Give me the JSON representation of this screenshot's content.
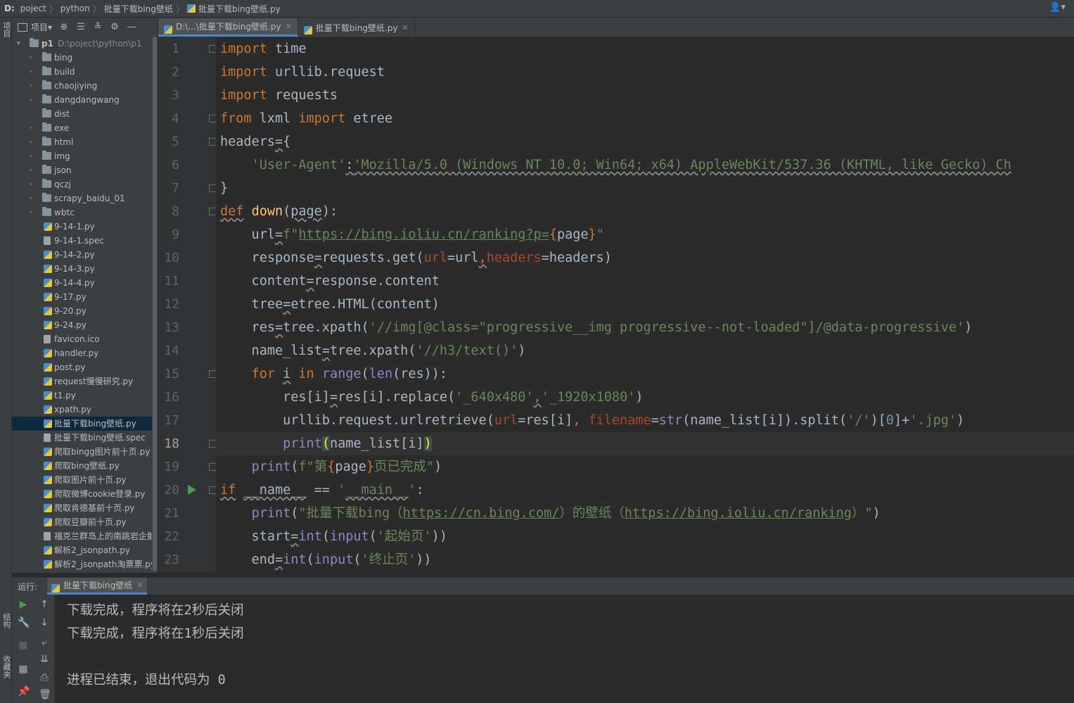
{
  "breadcrumb": {
    "drive": "D:",
    "items": [
      "poject",
      "python",
      "批量下载bing壁纸",
      "批量下载bing壁纸.py"
    ]
  },
  "left_strip": {
    "project_label": "项目",
    "structure_label": "结构",
    "favorites_label": "收藏夹"
  },
  "project_toolbar": {
    "view_label": "项目▾"
  },
  "tree": {
    "root": {
      "name": "p1",
      "path": "D:\\poject\\python\\p1"
    },
    "folders": [
      "bing",
      "build",
      "chaojiying",
      "dangdangwang",
      "dist",
      "exe",
      "html",
      "img",
      "json",
      "qczj",
      "scrapy_baidu_01",
      "wbtc"
    ],
    "files": [
      {
        "name": "9-14-1.py",
        "type": "py"
      },
      {
        "name": "9-14-1.spec",
        "type": "file"
      },
      {
        "name": "9-14-2.py",
        "type": "py"
      },
      {
        "name": "9-14-3.py",
        "type": "py"
      },
      {
        "name": "9-14-4.py",
        "type": "py"
      },
      {
        "name": "9-17.py",
        "type": "py"
      },
      {
        "name": "9-20.py",
        "type": "py"
      },
      {
        "name": "9-24.py",
        "type": "py"
      },
      {
        "name": "favicon.ico",
        "type": "file"
      },
      {
        "name": "handler.py",
        "type": "py"
      },
      {
        "name": "post.py",
        "type": "py"
      },
      {
        "name": "request慢慢研究.py",
        "type": "py"
      },
      {
        "name": "t1.py",
        "type": "py"
      },
      {
        "name": "xpath.py",
        "type": "py"
      },
      {
        "name": "批量下载bing壁纸.py",
        "type": "py",
        "selected": true
      },
      {
        "name": "批量下载bing壁纸.spec",
        "type": "file"
      },
      {
        "name": "爬取bingg图片前十页.py",
        "type": "py"
      },
      {
        "name": "爬取bing壁纸.py",
        "type": "py"
      },
      {
        "name": "爬取图片前十页.py",
        "type": "py"
      },
      {
        "name": "爬取微博cookie登录.py",
        "type": "py"
      },
      {
        "name": "爬取肯德基前十页.py",
        "type": "py"
      },
      {
        "name": "爬取豆瓣前十页.py",
        "type": "py"
      },
      {
        "name": "福克兰群岛上的南跳岩企鹅…",
        "type": "file"
      },
      {
        "name": "解析2_jsonpath.py",
        "type": "py"
      },
      {
        "name": "解析2_jsonpath淘票票.py",
        "type": "py"
      }
    ]
  },
  "editor_tabs": [
    {
      "label": "D:\\...\\批量下载bing壁纸.py",
      "active": true
    },
    {
      "label": "批量下载bing壁纸.py",
      "active": false
    }
  ],
  "editor": {
    "current_line": 18,
    "line_numbers": [
      "1",
      "2",
      "3",
      "4",
      "5",
      "6",
      "7",
      "8",
      "9",
      "10",
      "11",
      "12",
      "13",
      "14",
      "15",
      "16",
      "17",
      "18",
      "19",
      "20",
      "21",
      "22",
      "23"
    ],
    "code_lines": [
      "import time",
      "import urllib.request",
      "import requests",
      "from lxml import etree",
      "headers={",
      "    'User-Agent':'Mozilla/5.0 (Windows NT 10.0; Win64; x64) AppleWebKit/537.36 (KHTML, like Gecko) Ch",
      "}",
      "def down(page):",
      "    url=f\"https://bing.ioliu.cn/ranking?p={page}\"",
      "    response=requests.get(url=url,headers=headers)",
      "    content=response.content",
      "    tree=etree.HTML(content)",
      "    res=tree.xpath('//img[@class=\"progressive__img progressive--not-loaded\"]/@data-progressive')",
      "    name_list=tree.xpath('//h3/text()')",
      "    for i in range(len(res)):",
      "        res[i]=res[i].replace('_640x480','_1920x1080')",
      "        urllib.request.urlretrieve(url=res[i], filename=str(name_list[i]).split('/')[0]+'.jpg')",
      "        print(name_list[i])",
      "    print(f\"第{page}页已完成\")",
      "if __name__ == '__main__':",
      "    print(\"批量下载bing（https://cn.bing.com/）的壁纸（https://bing.ioliu.cn/ranking）\")",
      "    start=int(input('起始页'))",
      "    end=int(input('终止页'))"
    ]
  },
  "run_panel": {
    "label": "运行:",
    "tab": "批量下载bing壁纸",
    "output": [
      "下载完成，程序将在2秒后关闭",
      "下载完成，程序将在1秒后关闭",
      "",
      "进程已结束，退出代码为 0"
    ]
  },
  "colors": {
    "background": "#2b2b2b",
    "panel": "#3c3f41",
    "keyword": "#cc7832",
    "string": "#6a8759",
    "function": "#ffc66d",
    "accent": "#4a88c7"
  }
}
